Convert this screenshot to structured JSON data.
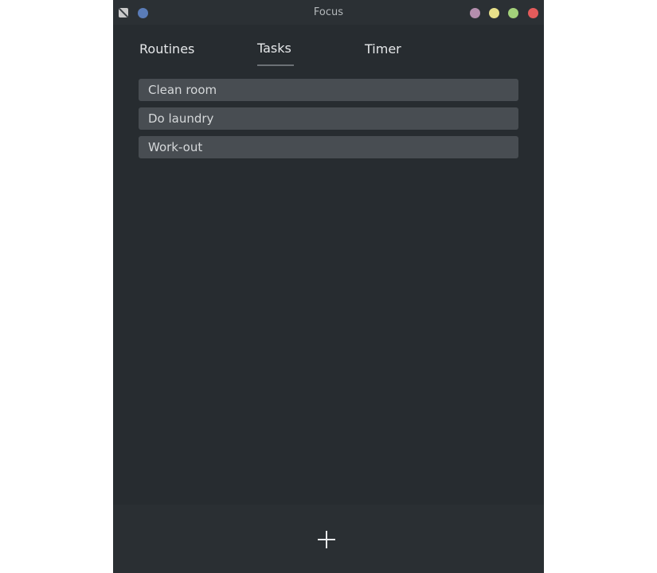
{
  "window": {
    "title": "Focus",
    "controls": [
      {
        "name": "menu-dot",
        "color": "#5a7cb8"
      },
      {
        "name": "minimize-dot",
        "color": "#b48ead"
      },
      {
        "name": "maximize-dot",
        "color": "#e8e08a"
      },
      {
        "name": "restore-dot",
        "color": "#a3d17a"
      },
      {
        "name": "close-dot",
        "color": "#e35b5b"
      }
    ]
  },
  "tabs": [
    {
      "label": "Routines",
      "active": false
    },
    {
      "label": "Tasks",
      "active": true
    },
    {
      "label": "Timer",
      "active": false
    }
  ],
  "tasks": [
    {
      "label": "Clean room"
    },
    {
      "label": "Do laundry"
    },
    {
      "label": "Work-out"
    }
  ],
  "footer": {
    "add_icon": "plus-icon"
  },
  "colors": {
    "window_bg": "#272c30",
    "item_bg": "#484d52",
    "text": "#e6e8ea"
  }
}
